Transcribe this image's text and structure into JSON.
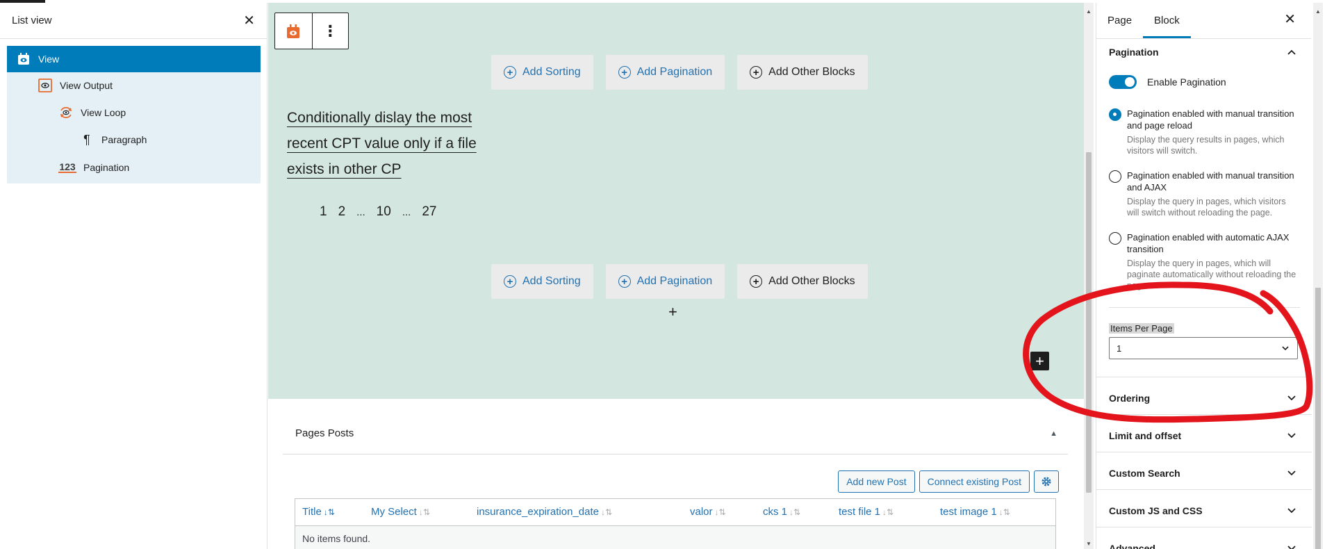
{
  "list_view": {
    "title": "List view",
    "items": [
      {
        "label": "View",
        "icon": "view-icon",
        "selected": true
      },
      {
        "label": "View Output",
        "icon": "view-output-icon"
      },
      {
        "label": "View Loop",
        "icon": "view-loop-icon"
      },
      {
        "label": "Paragraph",
        "icon": "paragraph-icon"
      },
      {
        "label": "Pagination",
        "icon": "pagination-icon"
      }
    ]
  },
  "canvas": {
    "appenders_top": [
      "Add Sorting",
      "Add Pagination",
      "Add Other Blocks"
    ],
    "appenders_bottom": [
      "Add Sorting",
      "Add Pagination",
      "Add Other Blocks"
    ],
    "post_title": "Conditionally dislay the most recent CPT value only if a file exists in other CP",
    "pagination": [
      "1",
      "2",
      "...",
      "10",
      "...",
      "27"
    ],
    "inserter": "+"
  },
  "metabox": {
    "title": "Pages Posts",
    "add_new": "Add new Post",
    "connect_existing": "Connect existing Post",
    "columns": [
      "Title",
      "My Select",
      "insurance_expiration_date",
      "valor",
      "cks 1",
      "test file 1",
      "test image 1"
    ],
    "empty": "No items found."
  },
  "inspector": {
    "tabs": [
      "Page",
      "Block"
    ],
    "active_tab": "Block",
    "pagination": {
      "heading": "Pagination",
      "toggle_label": "Enable Pagination",
      "toggle_on": true,
      "options": [
        {
          "label": "Pagination enabled with manual transition and page reload",
          "help": "Display the query results in pages, which visitors will switch.",
          "checked": true
        },
        {
          "label": "Pagination enabled with manual transition and AJAX",
          "help": "Display the query in pages, which visitors will switch without reloading the page.",
          "checked": false
        },
        {
          "label": "Pagination enabled with automatic AJAX transition",
          "help": "Display the query in pages, which will paginate automatically without reloading the page.",
          "checked": false
        }
      ],
      "items_per_page_label": "Items Per Page",
      "items_per_page_value": "1"
    },
    "panels": [
      "Ordering",
      "Limit and offset",
      "Custom Search",
      "Custom JS and CSS",
      "Advanced"
    ]
  },
  "colors": {
    "accent": "#007cba",
    "link_blue": "#2271b1",
    "canvas_bg": "#d3e6e0",
    "annotation_red": "#e3141b",
    "view_orange": "#e86a2e"
  }
}
